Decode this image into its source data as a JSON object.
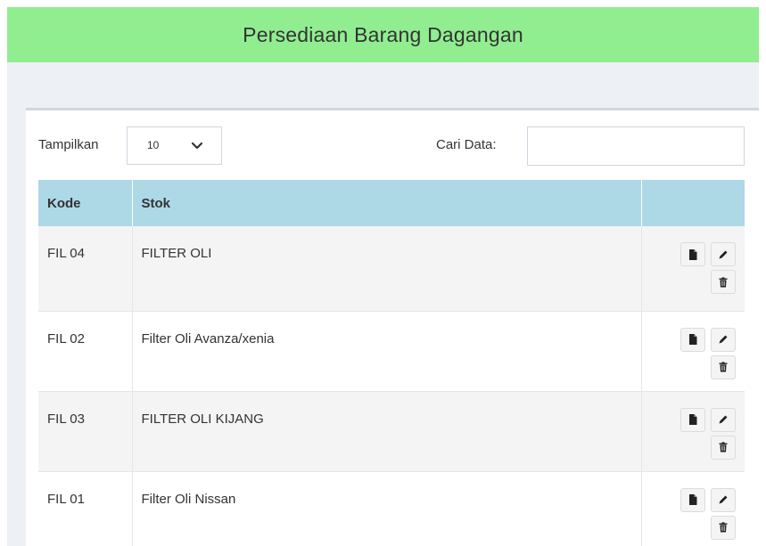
{
  "header": {
    "title": "Persediaan Barang Dagangan"
  },
  "controls": {
    "show_label": "Tampilkan",
    "page_size": "10",
    "search_label": "Cari Data:",
    "search_value": ""
  },
  "table": {
    "columns": [
      "Kode",
      "Stok",
      ""
    ],
    "rows": [
      {
        "kode": "FIL 04",
        "stok": "FILTER OLI"
      },
      {
        "kode": "FIL 02",
        "stok": "Filter Oli Avanza/xenia"
      },
      {
        "kode": "FIL 03",
        "stok": "FILTER OLI KIJANG"
      },
      {
        "kode": "FIL 01",
        "stok": "Filter Oli Nissan"
      }
    ]
  },
  "icons": [
    "file-icon",
    "pencil-icon",
    "trash-icon",
    "chevron-down-icon"
  ],
  "colors": {
    "header_bg": "#90ee90",
    "table_header_bg": "#add8e6",
    "page_bg": "#edf1f5",
    "striped_row_bg": "#f4f4f4"
  }
}
